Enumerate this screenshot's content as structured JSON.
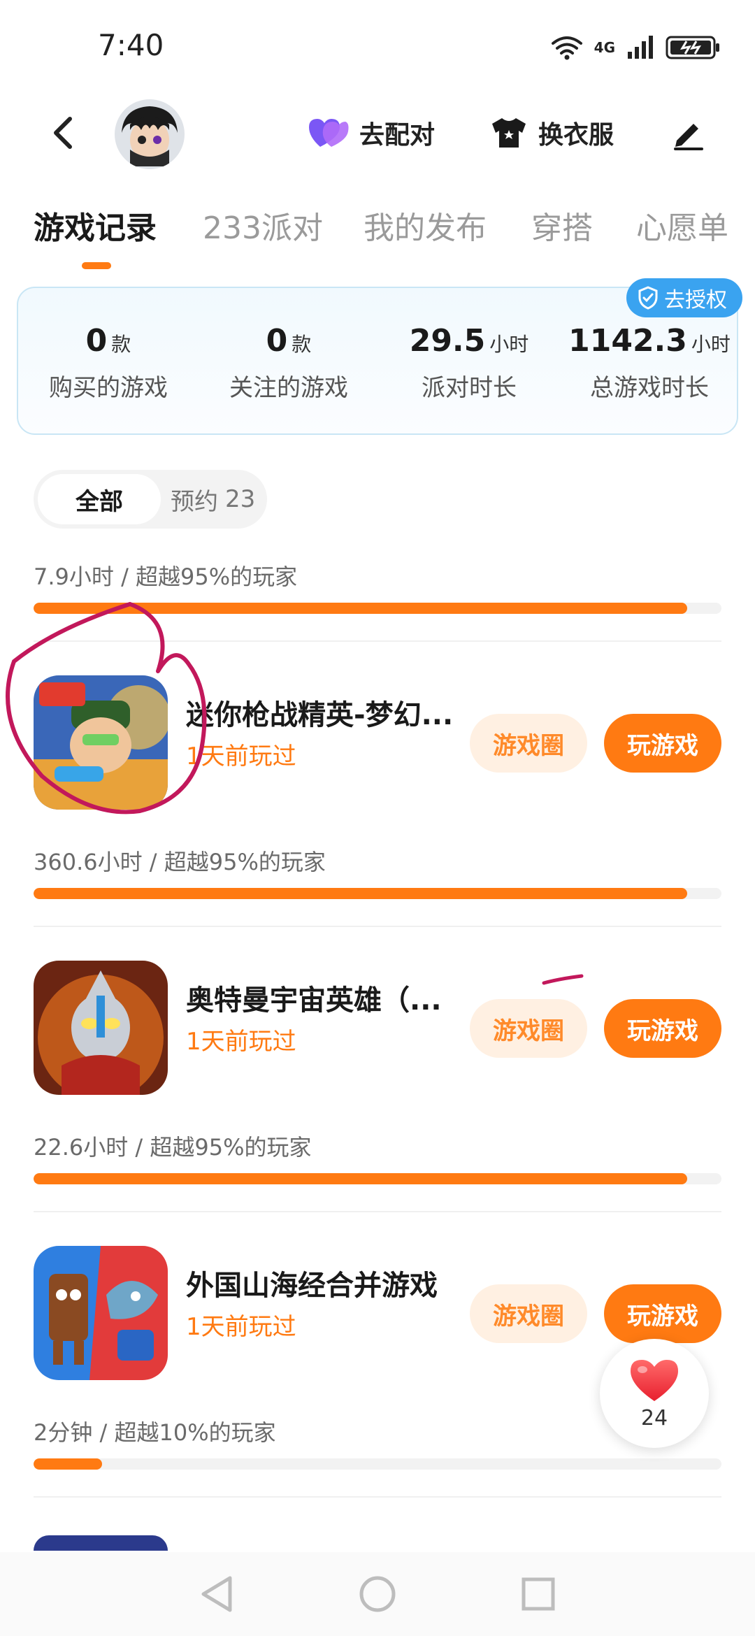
{
  "status_bar": {
    "time": "7:40",
    "network": "4G"
  },
  "header": {
    "match_label": "去配对",
    "outfit_label": "换衣服"
  },
  "tabs": [
    "游戏记录",
    "233派对",
    "我的发布",
    "穿搭",
    "心愿单"
  ],
  "stats": {
    "auth_label": "去授权",
    "items": [
      {
        "value": "0",
        "unit": "款",
        "label": "购买的游戏"
      },
      {
        "value": "0",
        "unit": "款",
        "label": "关注的游戏"
      },
      {
        "value": "29.5",
        "unit": "小时",
        "label": "派对时长"
      },
      {
        "value": "1142.3",
        "unit": "小时",
        "label": "总游戏时长"
      }
    ]
  },
  "filters": {
    "all": "全部",
    "reserve": "预约",
    "reserve_count": "23"
  },
  "games": [
    {
      "stats": "7.9小时 / 超越95%的玩家",
      "progress": 0.95,
      "name": "迷你枪战精英-梦幻...",
      "played": "1天前玩过",
      "circle": "游戏圈",
      "play": "玩游戏"
    },
    {
      "stats": "360.6小时 / 超越95%的玩家",
      "progress": 0.95,
      "name": "奥特曼宇宙英雄（...",
      "played": "1天前玩过",
      "circle": "游戏圈",
      "play": "玩游戏"
    },
    {
      "stats": "22.6小时 / 超越95%的玩家",
      "progress": 0.95,
      "name": "外国山海经合并游戏",
      "played": "1天前玩过",
      "circle": "游戏圈",
      "play": "玩游戏"
    },
    {
      "stats": "2分钟 / 超越10%的玩家",
      "progress": 0.1
    }
  ],
  "like": {
    "count": "24"
  },
  "colors": {
    "accent": "#ff7a12",
    "badge_blue": "#3aa3f0",
    "circle_bg": "#fff0e2",
    "annotation": "#c2185b"
  },
  "icons": [
    "back-arrow-icon",
    "heart-pair-icon",
    "tshirt-icon",
    "pen-icon",
    "shield-check-icon",
    "heart-icon",
    "nav-back-icon",
    "nav-home-icon",
    "nav-recents-icon"
  ]
}
